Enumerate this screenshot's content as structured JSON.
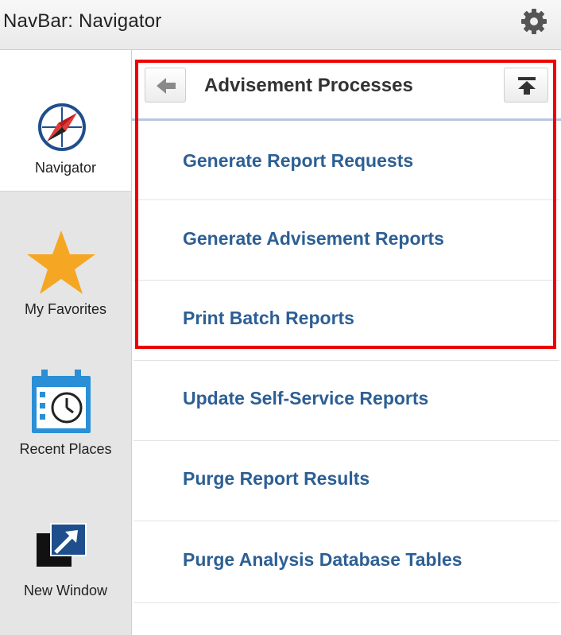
{
  "header": {
    "title": "NavBar: Navigator",
    "settings_icon": "gear-icon"
  },
  "sidebar": {
    "items": [
      {
        "label": "Navigator",
        "icon": "compass-icon",
        "active": true
      },
      {
        "label": "My Favorites",
        "icon": "star-icon",
        "active": false
      },
      {
        "label": "Recent Places",
        "icon": "calendar-clock-icon",
        "active": false
      },
      {
        "label": "New Window",
        "icon": "new-window-icon",
        "active": false
      }
    ]
  },
  "panel": {
    "title": "Advisement Processes",
    "back_icon": "arrow-left-icon",
    "top_icon": "arrow-to-top-icon",
    "items": [
      {
        "label": "Generate Report Requests",
        "highlighted": true
      },
      {
        "label": "Generate Advisement Reports",
        "highlighted": true
      },
      {
        "label": "Print Batch Reports",
        "highlighted": true
      },
      {
        "label": "Update Self-Service Reports",
        "highlighted": false
      },
      {
        "label": "Purge Report Results",
        "highlighted": false
      },
      {
        "label": "Purge Analysis Database Tables",
        "highlighted": false
      }
    ]
  },
  "colors": {
    "link": "#2d5f94",
    "highlight_border": "#ee0000",
    "star": "#f5a623",
    "calendar": "#2a8fd6"
  }
}
